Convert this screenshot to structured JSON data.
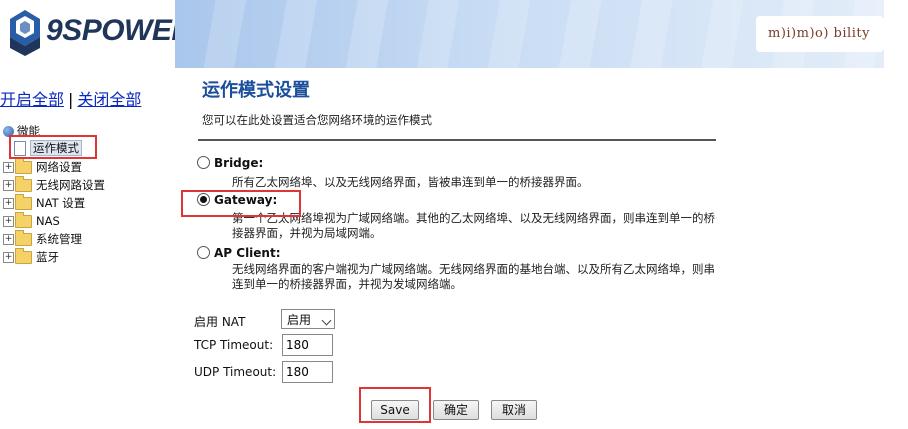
{
  "header": {
    "logo_text": "9SPOWER",
    "partner_logo_text": "m)i)m)o) bility"
  },
  "nav": {
    "expand_all": "开启全部",
    "separator": "|",
    "collapse_all": "关闭全部",
    "tree": {
      "root": "微能",
      "items": [
        "运作模式",
        "网络设置",
        "无线网路设置",
        "NAT 设置",
        "NAS",
        "系统管理",
        "蓝牙"
      ]
    }
  },
  "main": {
    "title": "运作模式设置",
    "description": "您可以在此处设置适合您网络环境的运作模式",
    "options": [
      {
        "label": "Bridge:",
        "checked": false,
        "desc": "所有乙太网络埠、以及无线网络界面，皆被串连到单一的桥接器界面。"
      },
      {
        "label": "Gateway:",
        "checked": true,
        "desc": "第一个乙太网络埠视为广域网络端。其他的乙太网络埠、以及无线网络界面，则串连到单一的桥接器界面，并视为局域网端。"
      },
      {
        "label": "AP Client:",
        "checked": false,
        "desc": "无线网络界面的客户端视为广域网络端。无线网络界面的基地台端、以及所有乙太网络埠，则串连到单一的桥接器界面，并视为发域网络端。"
      }
    ],
    "form": {
      "nat_label": "启用 NAT",
      "nat_value": "启用",
      "tcp_label": "TCP Timeout:",
      "tcp_value": "180",
      "udp_label": "UDP Timeout:",
      "udp_value": "180"
    },
    "buttons": {
      "save": "Save",
      "confirm": "确定",
      "cancel": "取消"
    }
  },
  "colors": {
    "title": "#1b4f9c",
    "link": "#0a28c0",
    "highlight_box": "#e03535"
  }
}
